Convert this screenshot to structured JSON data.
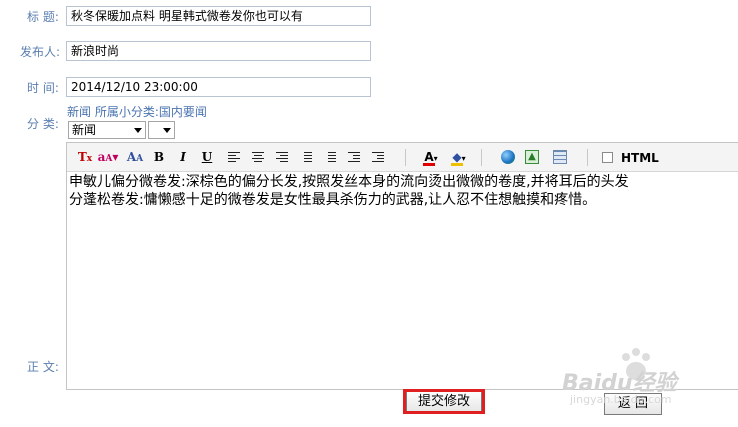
{
  "form": {
    "title_label": "标  题:",
    "title_value": "秋冬保暖加点料 明星韩式微卷发你也可以有",
    "publisher_label": "发布人:",
    "publisher_value": "新浪时尚",
    "time_label": "时  间:",
    "time_value": "2014/12/10 23:00:00",
    "category_label": "分  类:",
    "category_link_main": "新闻",
    "category_link_sub_label": "所属小分类:",
    "category_link_sub": "国内要闻",
    "category_select": "新闻",
    "subcategory_select": "",
    "body_label": "正  文:"
  },
  "toolbar": {
    "html_label": "HTML"
  },
  "editor": {
    "line1": "申敏儿偏分微卷发:深棕色的偏分长发,按照发丝本身的流向烫出微微的卷度,并将耳后的头发",
    "line2": "分蓬松卷发:慵懒感十足的微卷发是女性最具杀伤力的武器,让人忍不住想触摸和疼惜。"
  },
  "buttons": {
    "submit": "提交修改",
    "back": "返  回"
  },
  "watermark": {
    "brand": "Baidu经验",
    "url": "jingyan.baidu.com"
  },
  "colors": {
    "label": "#5b7fb0",
    "highlight": "#e02020"
  }
}
